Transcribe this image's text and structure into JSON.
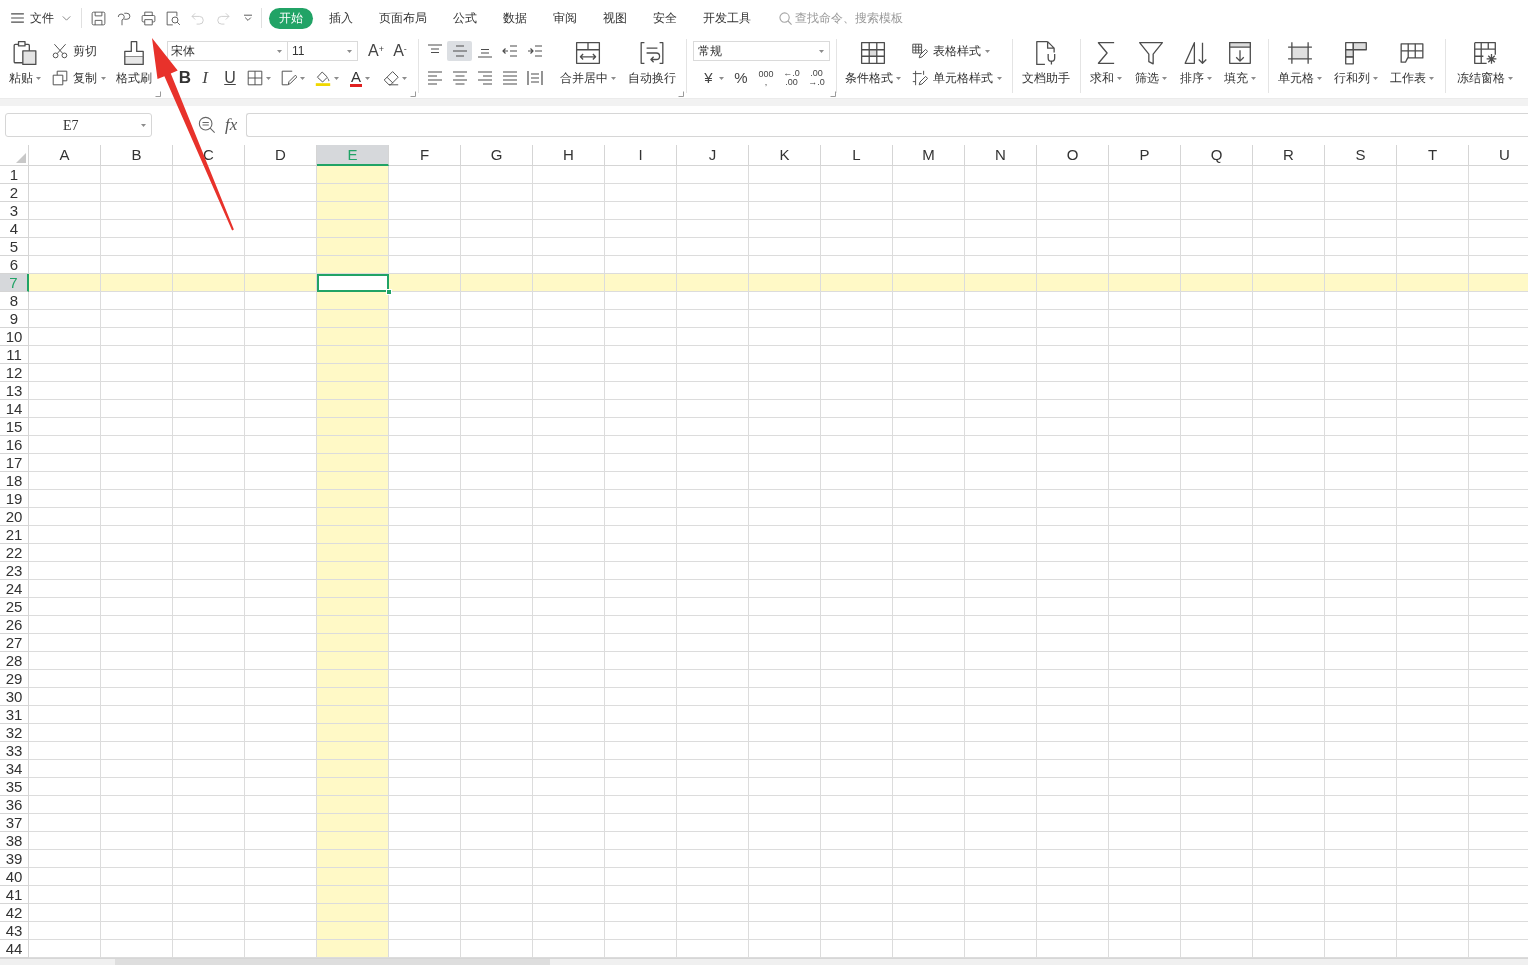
{
  "menu": {
    "label": "文件"
  },
  "quick_access": [
    {
      "disabled": false
    },
    {
      "disabled": false
    },
    {
      "disabled": false
    },
    {
      "disabled": false
    },
    {
      "disabled": true
    },
    {
      "disabled": true
    },
    {
      "disabled": false
    }
  ],
  "tabs": [
    {
      "label": "开始",
      "selected": true
    },
    {
      "label": "插入",
      "selected": false
    },
    {
      "label": "页面布局",
      "selected": false
    },
    {
      "label": "公式",
      "selected": false
    },
    {
      "label": "数据",
      "selected": false
    },
    {
      "label": "审阅",
      "selected": false
    },
    {
      "label": "视图",
      "selected": false
    },
    {
      "label": "安全",
      "selected": false
    },
    {
      "label": "开发工具",
      "selected": false
    }
  ],
  "search": {
    "placeholder": "查找命令、搜索模板"
  },
  "ribbon": {
    "paste": "粘贴",
    "cut": "剪切",
    "copy": "复制",
    "format_painter": "格式刷",
    "font_name": "宋体",
    "font_size": "11",
    "grow_font": "A$^{+}$",
    "shrink_font": "A$^{-}$",
    "bold": "B",
    "italic": "I",
    "underline": "U",
    "font_color": "A",
    "vertical_align": [
      {
        "selected": false
      },
      {
        "selected": true
      },
      {
        "selected": false
      }
    ],
    "horizontal_align": [
      {
        "selected": false
      },
      {
        "selected": false
      },
      {
        "selected": false
      },
      {
        "selected": false
      },
      {
        "selected": false
      }
    ],
    "merge": "合并居中",
    "wrap": "自动换行",
    "number_format": "常规",
    "currency": "¥",
    "percent": "%",
    "thousands": [
      "000",
      ","
    ],
    "increase_decimal": [
      "←.0",
      ".00"
    ],
    "decrease_decimal": [
      ".00",
      "→.0"
    ],
    "conditional_format": "条件格式",
    "table_style": "表格样式",
    "cell_style": "单元格样式",
    "doc_assistant": "文档助手",
    "sum": "求和",
    "filter": "筛选",
    "sort": "排序",
    "fill": "填充",
    "cells": "单元格",
    "rows_columns": "行和列",
    "worksheet": "工作表",
    "freeze": "冻结窗格"
  },
  "formula_bar": {
    "name_box": "E7",
    "function_label": "fx"
  },
  "columns": [
    {
      "label": "A",
      "selected": false
    },
    {
      "label": "B",
      "selected": false
    },
    {
      "label": "C",
      "selected": false
    },
    {
      "label": "D",
      "selected": false
    },
    {
      "label": "E",
      "selected": true
    },
    {
      "label": "F",
      "selected": false
    },
    {
      "label": "G",
      "selected": false
    },
    {
      "label": "H",
      "selected": false
    },
    {
      "label": "I",
      "selected": false
    },
    {
      "label": "J",
      "selected": false
    },
    {
      "label": "K",
      "selected": false
    },
    {
      "label": "L",
      "selected": false
    },
    {
      "label": "M",
      "selected": false
    },
    {
      "label": "N",
      "selected": false
    },
    {
      "label": "O",
      "selected": false
    },
    {
      "label": "P",
      "selected": false
    },
    {
      "label": "Q",
      "selected": false
    },
    {
      "label": "R",
      "selected": false
    },
    {
      "label": "S",
      "selected": false
    },
    {
      "label": "T",
      "selected": false
    },
    {
      "label": "U",
      "selected": false
    }
  ],
  "rows": [
    {
      "label": "1",
      "selected": false
    },
    {
      "label": "2",
      "selected": false
    },
    {
      "label": "3",
      "selected": false
    },
    {
      "label": "4",
      "selected": false
    },
    {
      "label": "5",
      "selected": false
    },
    {
      "label": "6",
      "selected": false
    },
    {
      "label": "7",
      "selected": true
    },
    {
      "label": "8",
      "selected": false
    },
    {
      "label": "9",
      "selected": false
    },
    {
      "label": "10",
      "selected": false
    },
    {
      "label": "11",
      "selected": false
    },
    {
      "label": "12",
      "selected": false
    },
    {
      "label": "13",
      "selected": false
    },
    {
      "label": "14",
      "selected": false
    },
    {
      "label": "15",
      "selected": false
    },
    {
      "label": "16",
      "selected": false
    },
    {
      "label": "17",
      "selected": false
    },
    {
      "label": "18",
      "selected": false
    },
    {
      "label": "19",
      "selected": false
    },
    {
      "label": "20",
      "selected": false
    },
    {
      "label": "21",
      "selected": false
    },
    {
      "label": "22",
      "selected": false
    },
    {
      "label": "23",
      "selected": false
    },
    {
      "label": "24",
      "selected": false
    },
    {
      "label": "25",
      "selected": false
    },
    {
      "label": "26",
      "selected": false
    },
    {
      "label": "27",
      "selected": false
    },
    {
      "label": "28",
      "selected": false
    },
    {
      "label": "29",
      "selected": false
    },
    {
      "label": "30",
      "selected": false
    },
    {
      "label": "31",
      "selected": false
    },
    {
      "label": "32",
      "selected": false
    },
    {
      "label": "33",
      "selected": false
    },
    {
      "label": "34",
      "selected": false
    },
    {
      "label": "35",
      "selected": false
    },
    {
      "label": "36",
      "selected": false
    },
    {
      "label": "37",
      "selected": false
    },
    {
      "label": "38",
      "selected": false
    },
    {
      "label": "39",
      "selected": false
    },
    {
      "label": "40",
      "selected": false
    },
    {
      "label": "41",
      "selected": false
    },
    {
      "label": "42",
      "selected": false
    },
    {
      "label": "43",
      "selected": false
    },
    {
      "label": "44",
      "selected": false
    }
  ]
}
